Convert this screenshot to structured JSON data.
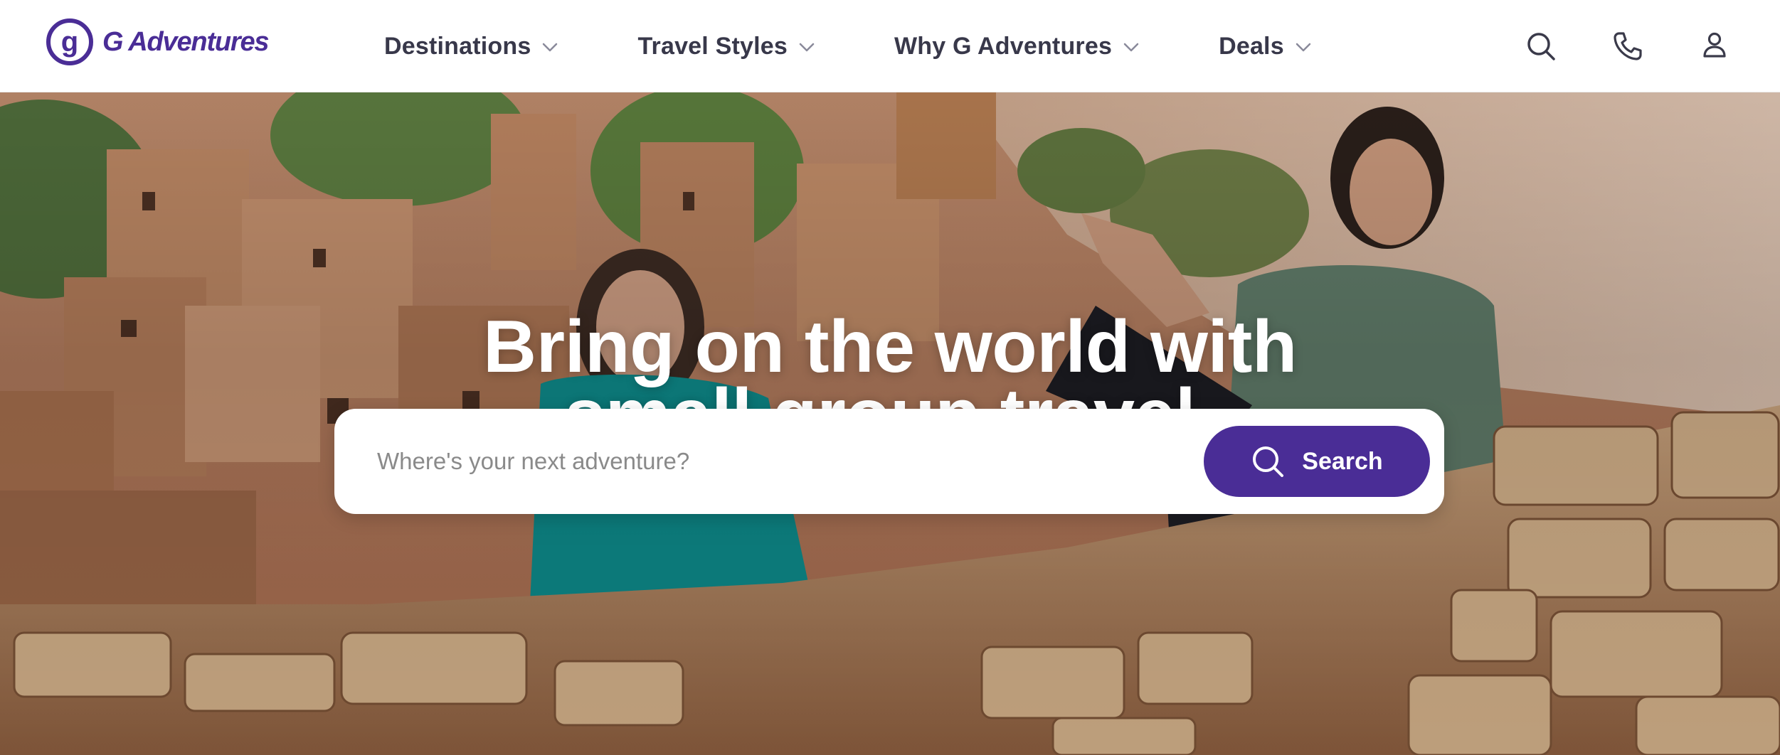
{
  "brand": {
    "name": "G Adventures",
    "color": "#4a2d96"
  },
  "nav": {
    "items": [
      {
        "label": "Destinations",
        "icon": "chevron-down-icon"
      },
      {
        "label": "Travel Styles",
        "icon": "chevron-down-icon"
      },
      {
        "label": "Why G Adventures",
        "icon": "chevron-down-icon"
      },
      {
        "label": "Deals",
        "icon": "chevron-down-icon"
      }
    ]
  },
  "header_icons": [
    "search-icon",
    "phone-icon",
    "user-icon"
  ],
  "hero": {
    "headline_line1": "Bring on the world with",
    "headline_line2": "small group travel.",
    "search": {
      "placeholder": "Where's your next adventure?",
      "button_label": "Search",
      "button_color": "#4a2d96"
    }
  }
}
